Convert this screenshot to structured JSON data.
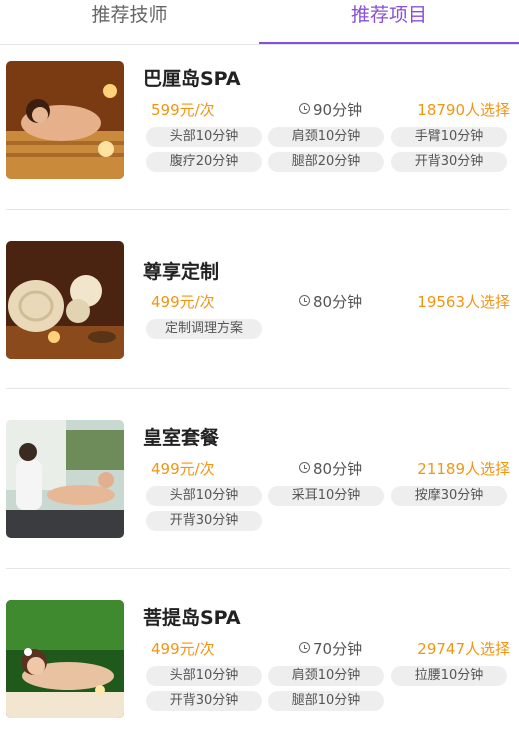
{
  "tabs": [
    {
      "label": "推荐技师",
      "active": false
    },
    {
      "label": "推荐项目",
      "active": true
    }
  ],
  "colors": {
    "accent": "#8a4fd8",
    "price": "#f39512",
    "tag_bg": "#eeeeee"
  },
  "items": [
    {
      "title": "巴厘岛SPA",
      "price": "599元/次",
      "duration": "90分钟",
      "chosen": "18790人选择",
      "tags": [
        "头部10分钟",
        "肩颈10分钟",
        "手臂10分钟",
        "腹疗20分钟",
        "腿部20分钟",
        "开背30分钟"
      ]
    },
    {
      "title": "尊享定制",
      "price": "499元/次",
      "duration": "80分钟",
      "chosen": "19563人选择",
      "tags": [
        "定制调理方案"
      ]
    },
    {
      "title": "皇室套餐",
      "price": "499元/次",
      "duration": "80分钟",
      "chosen": "21189人选择",
      "tags": [
        "头部10分钟",
        "采耳10分钟",
        "按摩30分钟",
        "开背30分钟"
      ]
    },
    {
      "title": "菩提岛SPA",
      "price": "499元/次",
      "duration": "70分钟",
      "chosen": "29747人选择",
      "tags": [
        "头部10分钟",
        "肩颈10分钟",
        "拉腰10分钟",
        "开背30分钟",
        "腿部10分钟"
      ]
    }
  ]
}
